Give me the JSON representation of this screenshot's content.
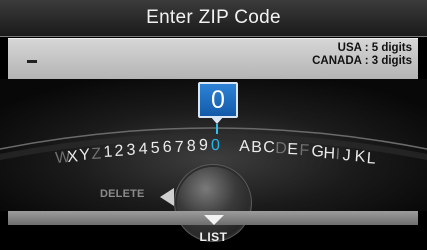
{
  "header": {
    "title": "Enter ZIP Code"
  },
  "input": {
    "hint_usa": "USA : 5 digits",
    "hint_canada": "CANADA : 3 digits"
  },
  "selector": {
    "selected_char": "0",
    "characters": [
      {
        "text": "W",
        "state": "dim"
      },
      {
        "text": "X",
        "state": "normal"
      },
      {
        "text": "Y",
        "state": "normal"
      },
      {
        "text": "Z",
        "state": "dim"
      },
      {
        "text": "1",
        "state": "normal"
      },
      {
        "text": "2",
        "state": "normal"
      },
      {
        "text": "3",
        "state": "normal"
      },
      {
        "text": "4",
        "state": "normal"
      },
      {
        "text": "5",
        "state": "normal"
      },
      {
        "text": "6",
        "state": "normal"
      },
      {
        "text": "7",
        "state": "normal"
      },
      {
        "text": "8",
        "state": "normal"
      },
      {
        "text": "9",
        "state": "normal"
      },
      {
        "text": "0",
        "state": "highlight"
      },
      {
        "text": "A",
        "state": "normal"
      },
      {
        "text": "B",
        "state": "normal"
      },
      {
        "text": "C",
        "state": "normal"
      },
      {
        "text": "D",
        "state": "dim"
      },
      {
        "text": "E",
        "state": "normal"
      },
      {
        "text": "F",
        "state": "dim"
      },
      {
        "text": "G",
        "state": "normal"
      },
      {
        "text": "H",
        "state": "normal"
      },
      {
        "text": "I",
        "state": "dim"
      },
      {
        "text": "J",
        "state": "normal"
      },
      {
        "text": "K",
        "state": "normal"
      },
      {
        "text": "L",
        "state": "normal"
      }
    ]
  },
  "controls": {
    "delete_label": "DELETE",
    "list_label": "LIST"
  },
  "icons": {
    "delete": "left-triangle-icon",
    "list": "down-triangle-icon",
    "knob": "interface-dial-icon"
  },
  "colors": {
    "highlight": "#26b7ef",
    "selected_box": "#1f6fc2",
    "dim_char": "#707070"
  }
}
